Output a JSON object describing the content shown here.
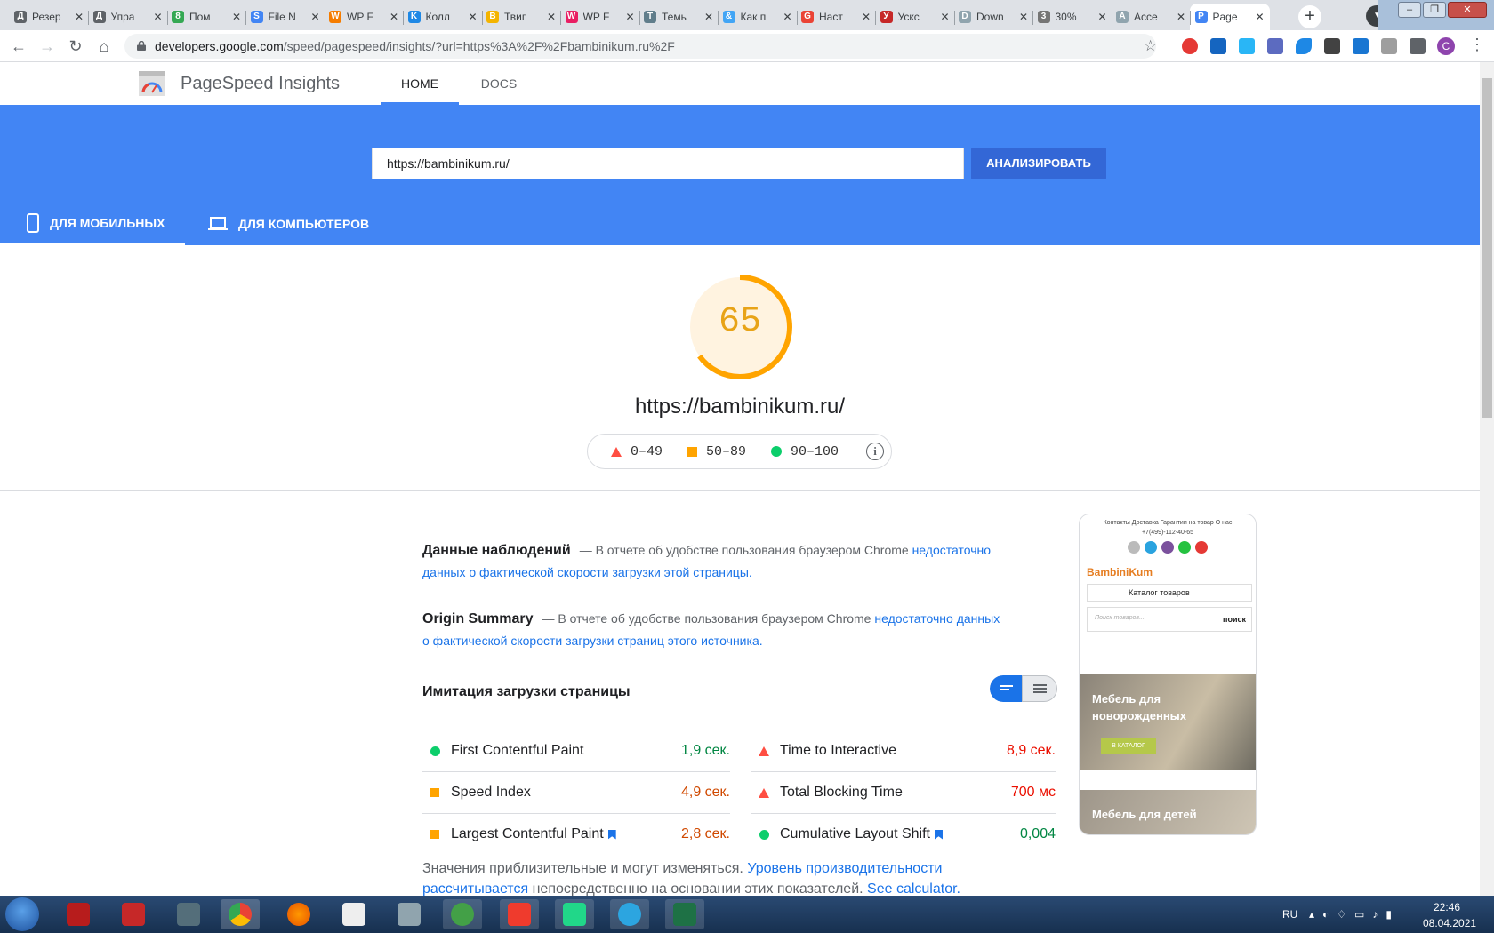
{
  "browser": {
    "tabs": [
      {
        "label": "Резер",
        "color": "#5f6368",
        "glyph": "Д"
      },
      {
        "label": "Упра",
        "color": "#5f6368",
        "glyph": "Д"
      },
      {
        "label": "Пом",
        "color": "#34a853",
        "glyph": "8"
      },
      {
        "label": "File N",
        "color": "#4285f4",
        "glyph": "S"
      },
      {
        "label": "WP F",
        "color": "#f57c00",
        "glyph": "W"
      },
      {
        "label": "Колл",
        "color": "#1e88e5",
        "glyph": "K"
      },
      {
        "label": "Твиг",
        "color": "#f4b400",
        "glyph": "B"
      },
      {
        "label": "WP F",
        "color": "#e91e63",
        "glyph": "W"
      },
      {
        "label": "Темь",
        "color": "#607d8b",
        "glyph": "T"
      },
      {
        "label": "Как п",
        "color": "#42a5f5",
        "glyph": "&"
      },
      {
        "label": "Наст",
        "color": "#ea4335",
        "glyph": "G"
      },
      {
        "label": "Ускс",
        "color": "#c62828",
        "glyph": "У"
      },
      {
        "label": "Down",
        "color": "#90a4ae",
        "glyph": "D"
      },
      {
        "label": "30%",
        "color": "#757575",
        "glyph": "3"
      },
      {
        "label": "Acce",
        "color": "#90a4ae",
        "glyph": "A"
      },
      {
        "label": "Page",
        "color": "#4285f4",
        "glyph": "P",
        "active": true
      }
    ],
    "new_tab": "+",
    "url_host": "developers.google.com",
    "url_path": "/speed/pagespeed/insights/?url=https%3A%2F%2Fbambinikum.ru%2F",
    "profile_initial": "C"
  },
  "header": {
    "title": "PageSpeed Insights",
    "nav": [
      "HOME",
      "DOCS"
    ]
  },
  "hero": {
    "url_value": "https://bambinikum.ru/",
    "analyze_label": "АНАЛИЗИРОВАТЬ",
    "tab_mobile": "ДЛЯ МОБИЛЬНЫХ",
    "tab_desktop": "ДЛЯ КОМПЬЮТЕРОВ"
  },
  "result": {
    "score": "65",
    "score_fraction": 0.65,
    "score_color": "#ffa400",
    "tested_url": "https://bambinikum.ru/",
    "legend": {
      "fail": "0–49",
      "average": "50–89",
      "pass": "90–100"
    }
  },
  "field_data": {
    "title": "Данные наблюдений",
    "text": "— В отчете об удобстве пользования браузером Chrome",
    "link": "недостаточно данных о фактической скорости загрузки этой страницы."
  },
  "origin_summary": {
    "title": "Origin Summary",
    "text": "— В отчете об удобстве пользования браузером Chrome",
    "link": "недостаточно данных о фактической скорости загрузки страниц этого источника."
  },
  "lab": {
    "title": "Имитация загрузки страницы",
    "metrics": [
      {
        "name": "First Contentful Paint",
        "value": "1,9 сек.",
        "status": "pass",
        "color": "#018642"
      },
      {
        "name": "Time to Interactive",
        "value": "8,9 сек.",
        "status": "fail",
        "color": "#eb0f00"
      },
      {
        "name": "Speed Index",
        "value": "4,9 сек.",
        "status": "average",
        "color": "#d04900"
      },
      {
        "name": "Total Blocking Time",
        "value": "700 мс",
        "status": "fail",
        "color": "#eb0f00"
      },
      {
        "name": "Largest Contentful Paint",
        "value": "2,8 сек.",
        "status": "average",
        "color": "#d04900",
        "bookmark": true
      },
      {
        "name": "Cumulative Layout Shift",
        "value": "0,004",
        "status": "pass",
        "color": "#018642",
        "bookmark": true
      }
    ],
    "footnote_text": "Значения приблизительные и могут изменяться.",
    "footnote_link": "Уровень производительности рассчитывается",
    "footnote_tail": "непосредственно на основании этих показателей.",
    "footnote_link2": "See calculator."
  },
  "screenshot": {
    "top_links": "Контакты   Доставка   Гарантии на товар   О нас",
    "phone": "+7(499)-112-40-65",
    "logo": "BambiniKum",
    "catalog": "Каталог товаров",
    "search_placeholder": "Поиск товаров...",
    "search_btn": "поиск",
    "banner1": "Мебель для новорожденных",
    "banner1_btn": "В КАТАЛОГ",
    "banner2": "Мебель для детей"
  },
  "taskbar": {
    "lang": "RU",
    "time": "22:46",
    "date": "08.04.2021"
  }
}
